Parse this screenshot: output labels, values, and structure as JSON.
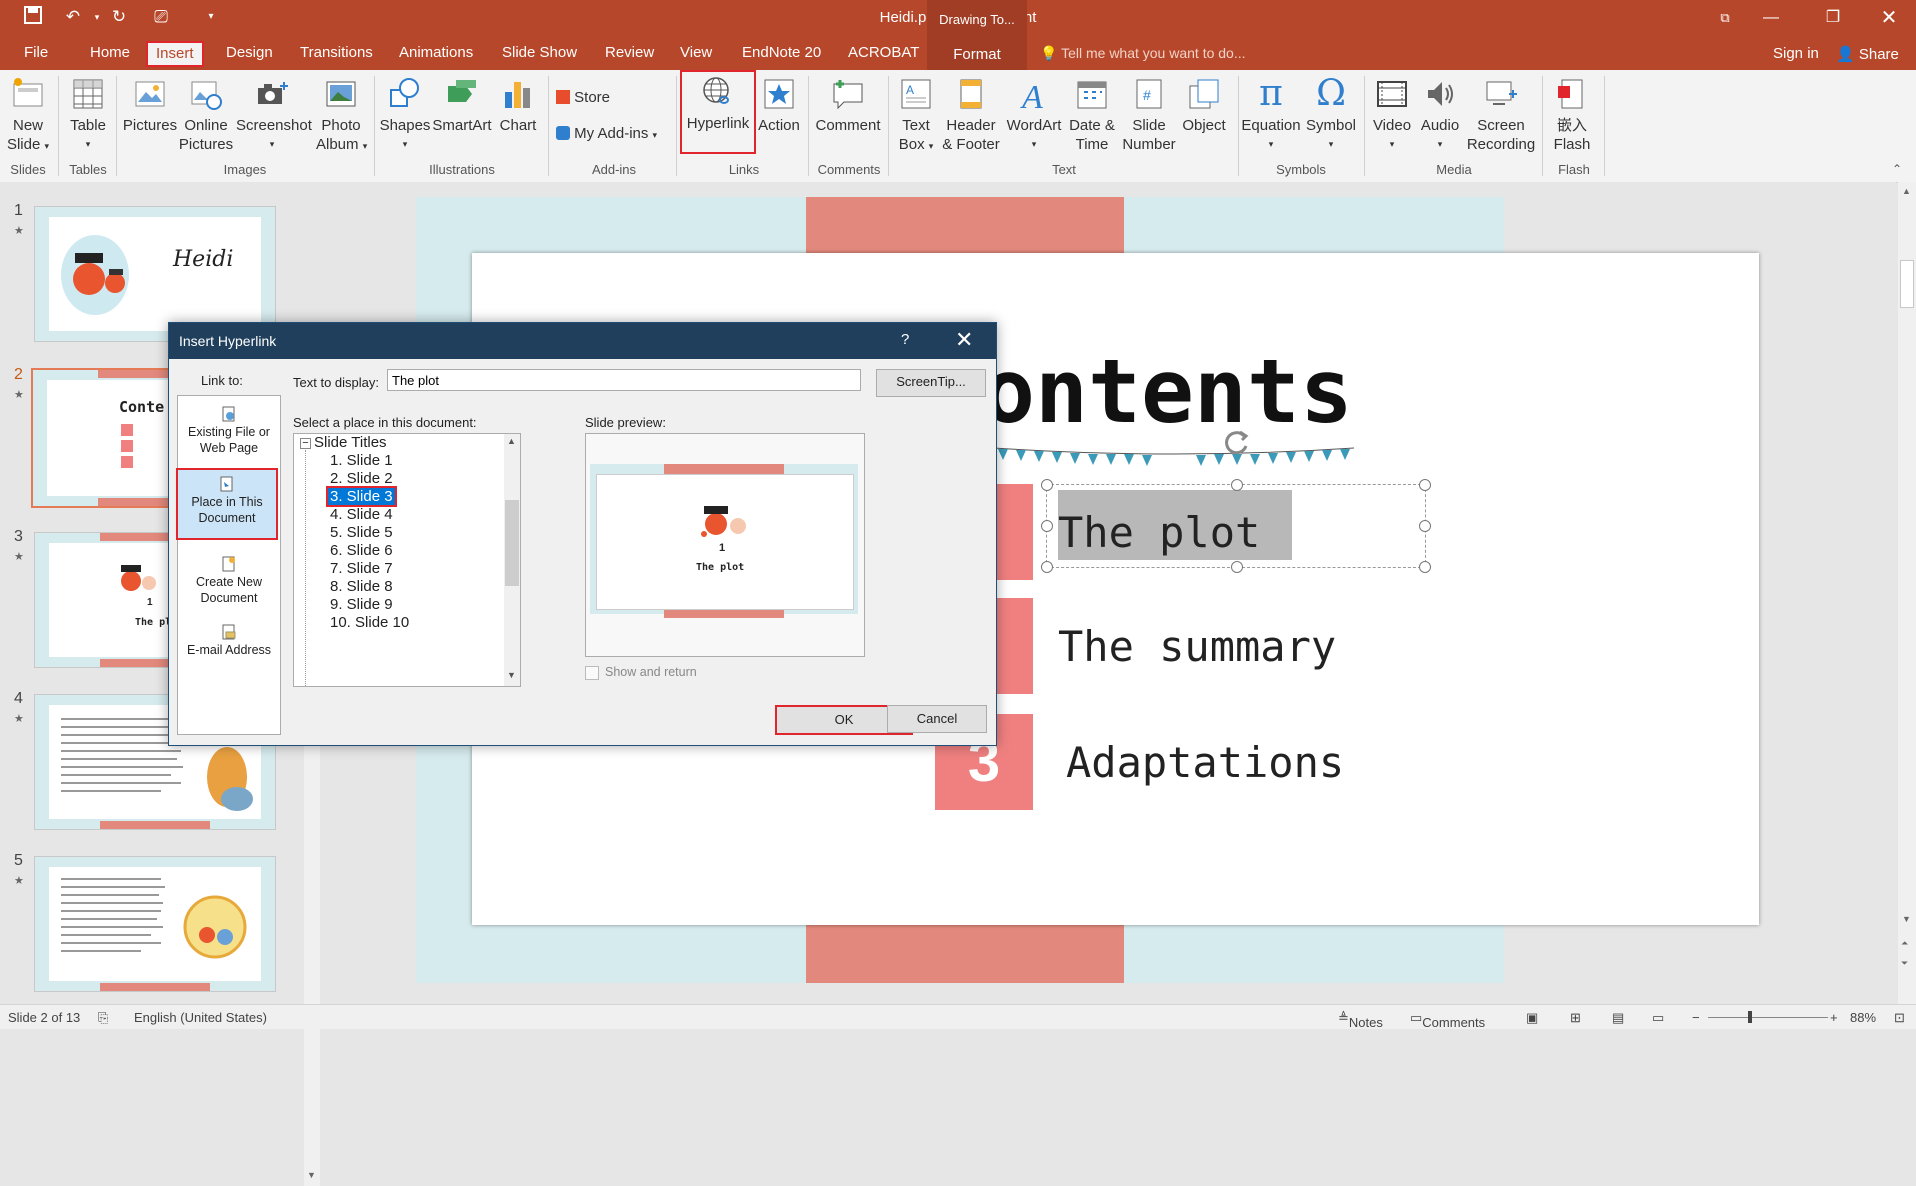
{
  "app": {
    "window_title": "Heidi.pptx - PowerPoint",
    "contextual_group": "Drawing To...",
    "tell_me": "Tell me what you want to do...",
    "sign_in": "Sign in",
    "share": "Share"
  },
  "tabs": [
    "File",
    "Home",
    "Insert",
    "Design",
    "Transitions",
    "Animations",
    "Slide Show",
    "Review",
    "View",
    "EndNote 20",
    "ACROBAT",
    "Format"
  ],
  "ribbon": {
    "groups": [
      "Slides",
      "Tables",
      "Images",
      "Illustrations",
      "Add-ins",
      "Links",
      "Comments",
      "Text",
      "Symbols",
      "Media",
      "Flash"
    ],
    "buttons": {
      "new_slide_1": "New",
      "new_slide_2": "Slide",
      "table": "Table",
      "pictures": "Pictures",
      "online_pictures_1": "Online",
      "online_pictures_2": "Pictures",
      "screenshot": "Screenshot",
      "photo_album_1": "Photo",
      "photo_album_2": "Album",
      "shapes": "Shapes",
      "smartart": "SmartArt",
      "chart": "Chart",
      "store": "Store",
      "my_addins": "My Add-ins",
      "hyperlink": "Hyperlink",
      "action": "Action",
      "comment": "Comment",
      "text_box_1": "Text",
      "text_box_2": "Box",
      "header_footer_1": "Header",
      "header_footer_2": "& Footer",
      "wordart": "WordArt",
      "date_time_1": "Date &",
      "date_time_2": "Time",
      "slide_number_1": "Slide",
      "slide_number_2": "Number",
      "object": "Object",
      "equation": "Equation",
      "symbol": "Symbol",
      "video": "Video",
      "audio": "Audio",
      "screen_recording_1": "Screen",
      "screen_recording_2": "Recording",
      "embed_flash_1": "嵌入",
      "embed_flash_2": "Flash"
    }
  },
  "thumbnails": [
    {
      "num": "1",
      "caption": "Heidi"
    },
    {
      "num": "2",
      "caption": "Conte"
    },
    {
      "num": "3",
      "caption": "The pl",
      "sub": "1"
    },
    {
      "num": "4",
      "caption": ""
    },
    {
      "num": "5",
      "caption": ""
    }
  ],
  "slide": {
    "title": "ontents",
    "items": [
      {
        "num": "",
        "text": "The plot"
      },
      {
        "num": "",
        "text": "The summary"
      },
      {
        "num": "3",
        "text": "Adaptations"
      }
    ]
  },
  "dialog": {
    "title": "Insert Hyperlink",
    "help": "?",
    "link_to_label": "Link to:",
    "link_to": [
      {
        "line1": "Existing File or",
        "line2": "Web Page"
      },
      {
        "line1": "Place in This",
        "line2": "Document"
      },
      {
        "line1": "Create New",
        "line2": "Document"
      },
      {
        "line1": "E-mail Address",
        "line2": ""
      }
    ],
    "text_to_display_label": "Text to display:",
    "text_to_display_value": "The plot",
    "screentip_button": "ScreenTip...",
    "select_place_label": "Select a place in this document:",
    "tree_root": "Slide Titles",
    "tree_items": [
      "1. Slide 1",
      "2. Slide 2",
      "3. Slide 3",
      "4. Slide 4",
      "5. Slide 5",
      "6. Slide 6",
      "7. Slide 7",
      "8. Slide 8",
      "9. Slide 9",
      "10. Slide 10"
    ],
    "selected_index": 2,
    "preview_label": "Slide preview:",
    "preview_number": "1",
    "preview_caption": "The plot",
    "show_and_return": "Show and return",
    "ok": "OK",
    "cancel": "Cancel"
  },
  "status": {
    "slide_of": "Slide 2 of 13",
    "language": "English (United States)",
    "notes": "Notes",
    "comments": "Comments",
    "zoom": "88%"
  },
  "colors": {
    "accent": "#b7472a",
    "dialog_title": "#1f3f5c",
    "highlight_red": "#e0262c",
    "number_box": "#f08080",
    "slide_frame": "#d6ebee",
    "slide_bar": "#e2887c"
  }
}
